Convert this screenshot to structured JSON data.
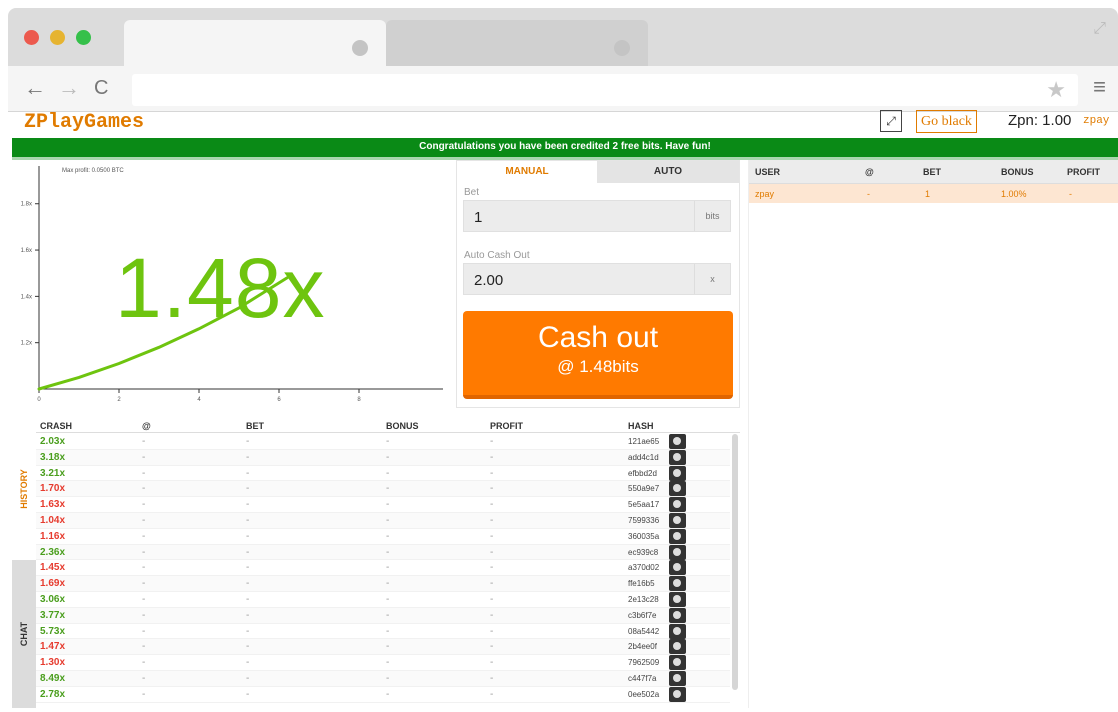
{
  "browser": {
    "back_icon": "←",
    "forward_icon": "→",
    "reload_icon": "C",
    "star_icon": "★",
    "menu_icon": "≡",
    "expand_icon": "⤢",
    "traffic_lights": [
      "#ec5a4e",
      "#e6b431",
      "#35c04a"
    ]
  },
  "header": {
    "logo": "ZPlayGames",
    "fullscreen_icon": "⤢",
    "go_black": "Go black",
    "balance": "Zpn: 1.00",
    "username": "zpay"
  },
  "banner": "Congratulations you have been credited 2 free bits. Have fun!",
  "chart_data": {
    "type": "line",
    "max_profit": "Max profit: 0.0500 BTC",
    "multiplier_text": "1.48x",
    "x_ticks": [
      "0",
      "2",
      "4",
      "6",
      "8"
    ],
    "y_ticks": [
      "1.8x",
      "1.6x",
      "1.4x",
      "1.2x"
    ],
    "xlim": [
      0,
      10
    ],
    "ylim": [
      1.0,
      1.95
    ],
    "series": [
      {
        "x": [
          0,
          1,
          2,
          3,
          4,
          5,
          6.2
        ],
        "y": [
          1.0,
          1.05,
          1.11,
          1.18,
          1.26,
          1.35,
          1.48
        ]
      }
    ]
  },
  "bet_panel": {
    "tabs": [
      "MANUAL",
      "AUTO"
    ],
    "bet_label": "Bet",
    "bet_value": "1",
    "bet_unit": "bits",
    "autocashout_label": "Auto Cash Out",
    "autocashout_value": "2.00",
    "autocashout_unit": "x",
    "cashout_label": "Cash out",
    "cashout_sub": "@ 1.48bits"
  },
  "players": {
    "headers": [
      "USER",
      "@",
      "BET",
      "BONUS",
      "PROFIT"
    ],
    "rows": [
      {
        "user": "zpay",
        "at": "-",
        "bet": "1",
        "bonus": "1.00%",
        "profit": "-"
      }
    ]
  },
  "side_tabs": [
    "HISTORY",
    "CHAT"
  ],
  "history": {
    "headers": [
      "CRASH",
      "@",
      "BET",
      "BONUS",
      "PROFIT",
      "HASH"
    ],
    "rows": [
      {
        "crash": "2.03x",
        "win": true,
        "at": "-",
        "bet": "-",
        "bonus": "-",
        "profit": "-",
        "hash": "121ae65"
      },
      {
        "crash": "3.18x",
        "win": true,
        "at": "-",
        "bet": "-",
        "bonus": "-",
        "profit": "-",
        "hash": "add4c1d"
      },
      {
        "crash": "3.21x",
        "win": true,
        "at": "-",
        "bet": "-",
        "bonus": "-",
        "profit": "-",
        "hash": "efbbd2d"
      },
      {
        "crash": "1.70x",
        "win": false,
        "at": "-",
        "bet": "-",
        "bonus": "-",
        "profit": "-",
        "hash": "550a9e7"
      },
      {
        "crash": "1.63x",
        "win": false,
        "at": "-",
        "bet": "-",
        "bonus": "-",
        "profit": "-",
        "hash": "5e5aa17"
      },
      {
        "crash": "1.04x",
        "win": false,
        "at": "-",
        "bet": "-",
        "bonus": "-",
        "profit": "-",
        "hash": "7599336"
      },
      {
        "crash": "1.16x",
        "win": false,
        "at": "-",
        "bet": "-",
        "bonus": "-",
        "profit": "-",
        "hash": "360035a"
      },
      {
        "crash": "2.36x",
        "win": true,
        "at": "-",
        "bet": "-",
        "bonus": "-",
        "profit": "-",
        "hash": "ec939c8"
      },
      {
        "crash": "1.45x",
        "win": false,
        "at": "-",
        "bet": "-",
        "bonus": "-",
        "profit": "-",
        "hash": "a370d02"
      },
      {
        "crash": "1.69x",
        "win": false,
        "at": "-",
        "bet": "-",
        "bonus": "-",
        "profit": "-",
        "hash": "ffe16b5"
      },
      {
        "crash": "3.06x",
        "win": true,
        "at": "-",
        "bet": "-",
        "bonus": "-",
        "profit": "-",
        "hash": "2e13c28"
      },
      {
        "crash": "3.77x",
        "win": true,
        "at": "-",
        "bet": "-",
        "bonus": "-",
        "profit": "-",
        "hash": "c3b6f7e"
      },
      {
        "crash": "5.73x",
        "win": true,
        "at": "-",
        "bet": "-",
        "bonus": "-",
        "profit": "-",
        "hash": "08a5442"
      },
      {
        "crash": "1.47x",
        "win": false,
        "at": "-",
        "bet": "-",
        "bonus": "-",
        "profit": "-",
        "hash": "2b4ee0f"
      },
      {
        "crash": "1.30x",
        "win": false,
        "at": "-",
        "bet": "-",
        "bonus": "-",
        "profit": "-",
        "hash": "7962509"
      },
      {
        "crash": "8.49x",
        "win": true,
        "at": "-",
        "bet": "-",
        "bonus": "-",
        "profit": "-",
        "hash": "c447f7a"
      },
      {
        "crash": "2.78x",
        "win": true,
        "at": "-",
        "bet": "-",
        "bonus": "-",
        "profit": "-",
        "hash": "0ee502a"
      }
    ]
  },
  "colors": {
    "brand": "#e07b00",
    "win": "#4a9e1d",
    "loss": "#e63b2e",
    "banner": "#0a8a16",
    "curve": "#6ec40f"
  }
}
